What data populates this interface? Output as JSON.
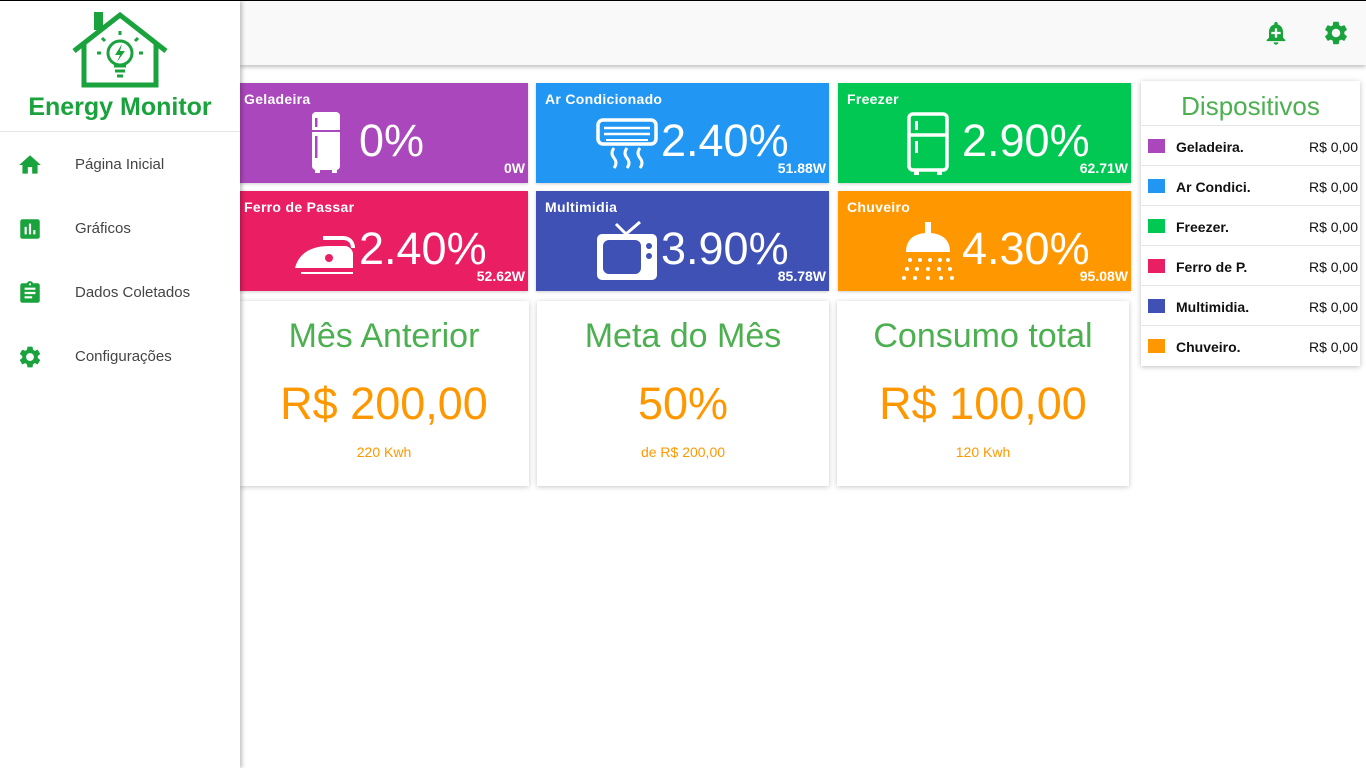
{
  "app": {
    "title": "Energy Monitor"
  },
  "colors": {
    "brand_green": "#1aa33d",
    "accent_green": "#4caf50",
    "accent_orange": "#ff9800"
  },
  "sidebar": {
    "items": [
      {
        "label": "Página Inicial",
        "icon": "home-icon"
      },
      {
        "label": "Gráficos",
        "icon": "chart-icon"
      },
      {
        "label": "Dados Coletados",
        "icon": "clipboard-icon"
      },
      {
        "label": "Configurações",
        "icon": "gear-icon"
      }
    ]
  },
  "topbar": {
    "icons": [
      "bell-plus-icon",
      "gear-icon"
    ]
  },
  "devices": [
    {
      "name": "Geladeira",
      "percent": "0%",
      "watts": "0W",
      "color": "#ab47bc",
      "icon": "fridge-icon"
    },
    {
      "name": "Ar Condicionado",
      "percent": "2.40%",
      "watts": "51.88W",
      "color": "#2196f3",
      "icon": "air-conditioner-icon"
    },
    {
      "name": "Freezer",
      "percent": "2.90%",
      "watts": "62.71W",
      "color": "#00c853",
      "icon": "freezer-icon"
    },
    {
      "name": "Ferro de Passar",
      "percent": "2.40%",
      "watts": "52.62W",
      "color": "#e91e63",
      "icon": "iron-icon"
    },
    {
      "name": "Multimidia",
      "percent": "3.90%",
      "watts": "85.78W",
      "color": "#3f51b5",
      "icon": "tv-icon"
    },
    {
      "name": "Chuveiro",
      "percent": "4.30%",
      "watts": "95.08W",
      "color": "#ff9800",
      "icon": "shower-icon"
    }
  ],
  "summary": [
    {
      "title": "Mês Anterior",
      "value": "R$ 200,00",
      "sub": "220 Kwh"
    },
    {
      "title": "Meta do Mês",
      "value": "50%",
      "sub": "de R$ 200,00"
    },
    {
      "title": "Consumo total",
      "value": "R$ 100,00",
      "sub": "120 Kwh"
    }
  ],
  "dispositivos": {
    "title": "Dispositivos",
    "rows": [
      {
        "label": "Geladeira.",
        "price": "R$ 0,00",
        "color": "#ab47bc"
      },
      {
        "label": "Ar Condici.",
        "price": "R$ 0,00",
        "color": "#2196f3"
      },
      {
        "label": "Freezer.",
        "price": "R$ 0,00",
        "color": "#00c853"
      },
      {
        "label": "Ferro de P.",
        "price": "R$ 0,00",
        "color": "#e91e63"
      },
      {
        "label": "Multimidia.",
        "price": "R$ 0,00",
        "color": "#3f51b5"
      },
      {
        "label": "Chuveiro.",
        "price": "R$ 0,00",
        "color": "#ff9800"
      }
    ]
  }
}
